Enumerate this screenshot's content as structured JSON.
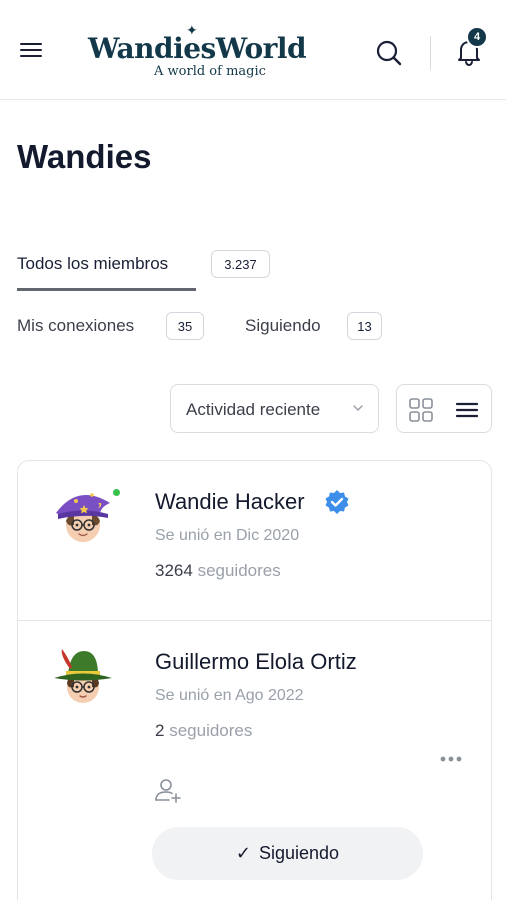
{
  "header": {
    "logo_title": "WandiesWorld",
    "logo_tagline": "A world of magic",
    "notifications_count": "4",
    "icons": [
      "menu-icon",
      "search-icon",
      "bell-icon"
    ]
  },
  "page": {
    "title": "Wandies"
  },
  "tabs": {
    "all": {
      "label": "Todos los miembros",
      "count": "3.237"
    },
    "connections": {
      "label": "Mis conexiones",
      "count": "35"
    },
    "following": {
      "label": "Siguiendo",
      "count": "13"
    }
  },
  "filters": {
    "sort_label": "Actividad reciente",
    "view_icons": [
      "grid-view-icon",
      "list-view-icon"
    ]
  },
  "members": [
    {
      "name": "Wandie Hacker",
      "joined": "Se unió en Dic 2020",
      "followers_count": "3264",
      "followers_label": "seguidores",
      "verified": true,
      "online": true
    },
    {
      "name": "Guillermo Elola Ortiz",
      "joined": "Se unió en Ago 2022",
      "followers_count": "2",
      "followers_label": "seguidores",
      "follow_button": "Siguiendo"
    }
  ],
  "colors": {
    "brand": "#12384a",
    "online": "#36c24a",
    "verified": "#3d8ee8",
    "muted_text": "#9aa0aa"
  }
}
